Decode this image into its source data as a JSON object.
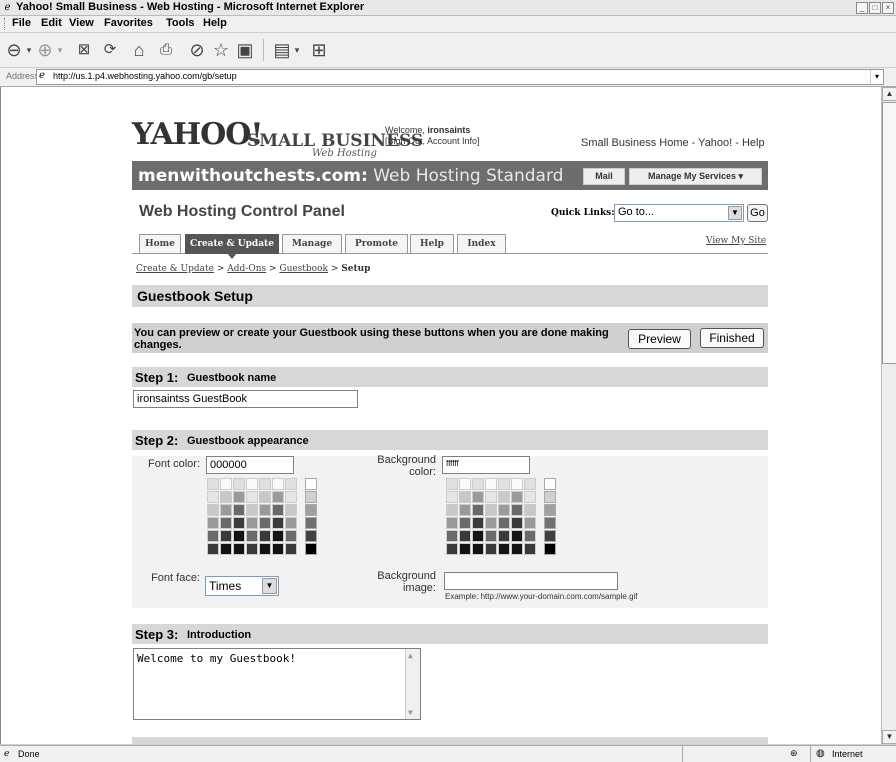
{
  "window": {
    "title": "Yahoo! Small Business - Web Hosting - Microsoft Internet Explorer",
    "controls": [
      "_",
      "□",
      "×"
    ]
  },
  "menu": [
    "File",
    "Edit",
    "View",
    "Favorites",
    "Tools",
    "Help"
  ],
  "toolbar_icons": [
    "back-icon",
    "forward-icon",
    "stop-icon",
    "refresh-icon",
    "home-icon",
    "search-icon",
    "history-icon",
    "favorites-icon",
    "media-icon",
    "print-icon",
    "edit-icon",
    "messenger-icon"
  ],
  "address": {
    "label": "Address",
    "url": "http://us.1.p4.webhosting.yahoo.com/gb/setup"
  },
  "header": {
    "logo_yahoo": "YAHOO!",
    "logo_sb": "SMALL BUSINESS",
    "logo_wh": "Web Hosting",
    "welcome_prefix": "Welcome, ",
    "welcome_user": "ironsaints",
    "welcome_links": "[Sign Out, Account Info]",
    "top_links": "Small Business Home - Yahoo! - Help"
  },
  "domainbar": {
    "domain": "menwithoutchests.com:",
    "plan": " Web Hosting Standard",
    "mail": "Mail",
    "manage": "Manage My Services ▾"
  },
  "control_panel": {
    "title": "Web Hosting Control Panel",
    "quick_links_label": "Quick Links:",
    "quick_links_value": "Go to...",
    "go": "Go",
    "view_site": "View My Site"
  },
  "tabs": [
    {
      "label": "Home",
      "active": false
    },
    {
      "label": "Create & Update",
      "active": true
    },
    {
      "label": "Manage",
      "active": false
    },
    {
      "label": "Promote",
      "active": false
    },
    {
      "label": "Help",
      "active": false
    },
    {
      "label": "Index",
      "active": false
    }
  ],
  "breadcrumb": {
    "c1": "Create & Update",
    "sep": " > ",
    "c2": "Add-Ons",
    "c3": "Guestbook",
    "current": "Setup"
  },
  "page": {
    "heading": "Guestbook Setup",
    "notice": "You can preview or create your Guestbook using these buttons when you are done making changes.",
    "preview": "Preview",
    "finished": "Finished"
  },
  "step1": {
    "num": "Step 1:",
    "desc": "Guestbook name",
    "value": "ironsaintss GuestBook"
  },
  "step2": {
    "num": "Step 2:",
    "desc": "Guestbook appearance",
    "font_color_label": "Font color:",
    "font_color_value": "000000",
    "bg_color_label": "Background color:",
    "bg_color_value": "ffffff",
    "font_face_label": "Font face:",
    "font_face_value": "Times",
    "bg_image_label": "Background image:",
    "bg_image_value": "",
    "example": "Example: http://www.your-domain.com.com/sample.gif"
  },
  "step3": {
    "num": "Step 3:",
    "desc": "Introduction",
    "value": "Welcome to my Guestbook!"
  },
  "status": {
    "text": "Done",
    "zone": "Internet"
  }
}
